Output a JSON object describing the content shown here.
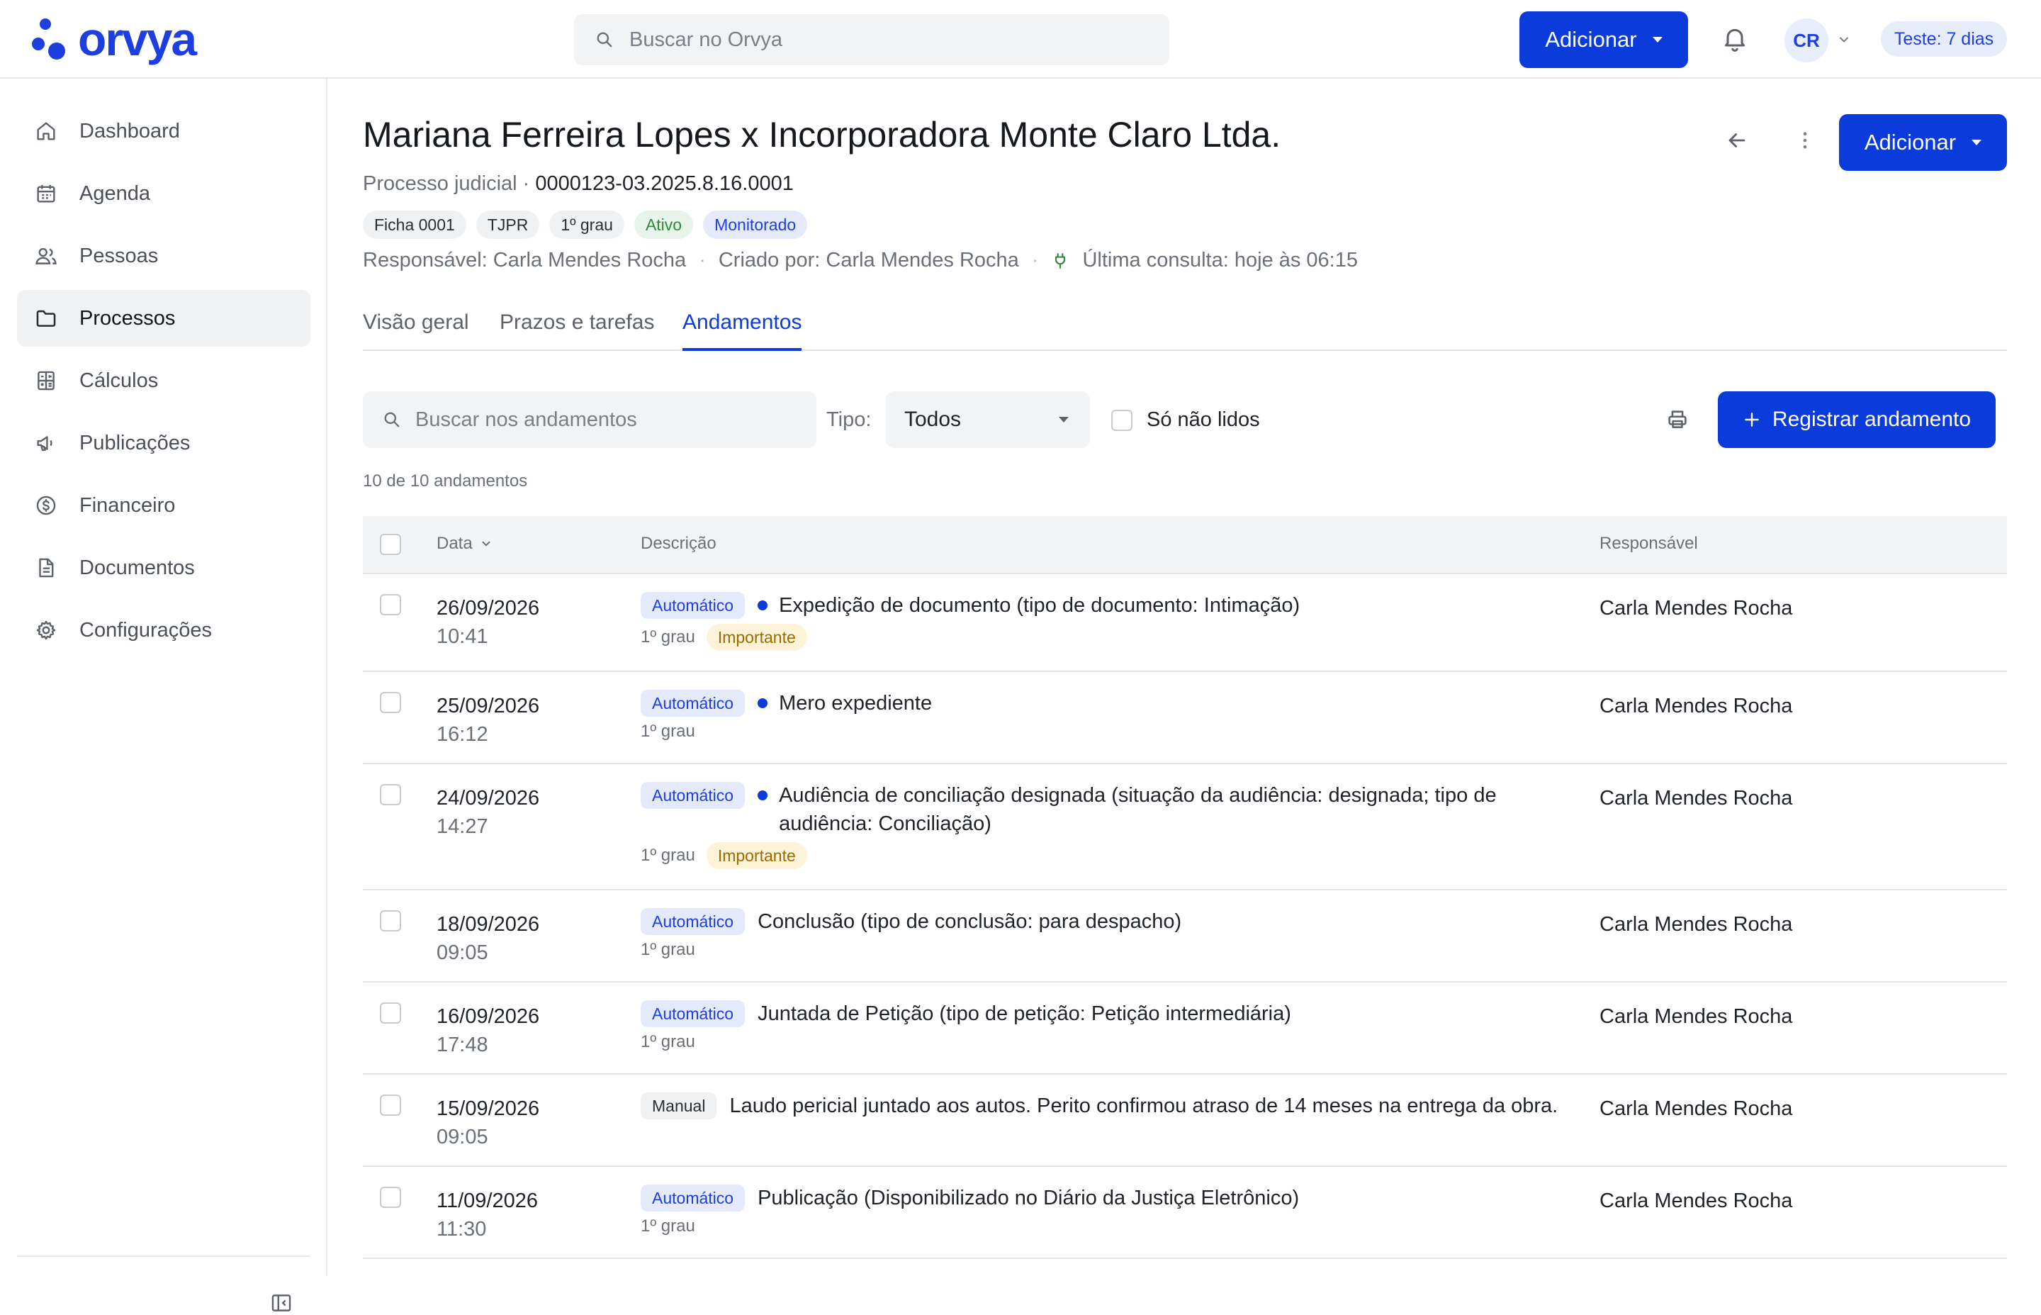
{
  "app": {
    "brand": "orvya"
  },
  "topbar": {
    "search_placeholder": "Buscar no Orvya",
    "add_label": "Adicionar",
    "avatar_initials": "CR",
    "trial_badge": "Teste: 7 dias"
  },
  "sidebar": {
    "items": [
      {
        "label": "Dashboard",
        "icon": "home-icon"
      },
      {
        "label": "Agenda",
        "icon": "calendar-icon"
      },
      {
        "label": "Pessoas",
        "icon": "people-icon"
      },
      {
        "label": "Processos",
        "icon": "folder-icon",
        "active": true
      },
      {
        "label": "Cálculos",
        "icon": "calculator-icon"
      },
      {
        "label": "Publicações",
        "icon": "megaphone-icon"
      },
      {
        "label": "Financeiro",
        "icon": "dollar-icon"
      },
      {
        "label": "Documentos",
        "icon": "document-icon"
      },
      {
        "label": "Configurações",
        "icon": "gear-icon"
      }
    ]
  },
  "case": {
    "title": "Mariana Ferreira Lopes x Incorporadora Monte Claro Ltda.",
    "type_label": "Processo judicial ·",
    "number": "0000123-03.2025.8.16.0001",
    "chips": [
      "Ficha 0001",
      "TJPR",
      "1º grau",
      "Ativo",
      "Monitorado"
    ],
    "responsible": "Responsável: Carla Mendes Rocha",
    "created_by": "Criado por: Carla Mendes Rocha",
    "last_check": "Última consulta: hoje às 06:15",
    "add_label": "Adicionar"
  },
  "tabs": [
    "Visão geral",
    "Prazos e tarefas",
    "Andamentos"
  ],
  "active_tab": "Andamentos",
  "filters": {
    "search_placeholder": "Buscar nos andamentos",
    "type_label": "Tipo:",
    "type_value": "Todos",
    "unread_only_label": "Só não lidos",
    "register_label": "Registrar andamento"
  },
  "count_text": "10 de 10 andamentos",
  "table": {
    "columns": [
      "Data",
      "Descrição",
      "Responsável"
    ],
    "rows": [
      {
        "date": "26/09/2026",
        "time": "10:41",
        "source": "Automático",
        "unread": true,
        "description": "Expedição de documento (tipo de documento: Intimação)",
        "instance": "1º grau",
        "important": "Importante",
        "responsible": "Carla Mendes Rocha"
      },
      {
        "date": "25/09/2026",
        "time": "16:12",
        "source": "Automático",
        "unread": true,
        "description": "Mero expediente",
        "instance": "1º grau",
        "important": "",
        "responsible": "Carla Mendes Rocha"
      },
      {
        "date": "24/09/2026",
        "time": "14:27",
        "source": "Automático",
        "unread": true,
        "description": "Audiência de conciliação designada (situação da audiência: designada; tipo de audiência: Conciliação)",
        "instance": "1º grau",
        "important": "Importante",
        "responsible": "Carla Mendes Rocha"
      },
      {
        "date": "18/09/2026",
        "time": "09:05",
        "source": "Automático",
        "unread": false,
        "description": "Conclusão (tipo de conclusão: para despacho)",
        "instance": "1º grau",
        "important": "",
        "responsible": "Carla Mendes Rocha"
      },
      {
        "date": "16/09/2026",
        "time": "17:48",
        "source": "Automático",
        "unread": false,
        "description": "Juntada de Petição (tipo de petição: Petição intermediária)",
        "instance": "1º grau",
        "important": "",
        "responsible": "Carla Mendes Rocha"
      },
      {
        "date": "15/09/2026",
        "time": "09:05",
        "source": "Manual",
        "unread": false,
        "description": "Laudo pericial juntado aos autos. Perito confirmou atraso de 14 meses na entrega da obra.",
        "instance": "",
        "important": "",
        "responsible": "Carla Mendes Rocha"
      },
      {
        "date": "11/09/2026",
        "time": "11:30",
        "source": "Automático",
        "unread": false,
        "description": "Publicação (Disponibilizado no Diário da Justiça Eletrônico)",
        "instance": "1º grau",
        "important": "",
        "responsible": "Carla Mendes Rocha"
      }
    ]
  },
  "colors": {
    "accent": "#0b3bdb",
    "brand": "#1d3ee0",
    "active_green": "#2f8a3e",
    "important_bg": "#fdf3d8"
  }
}
